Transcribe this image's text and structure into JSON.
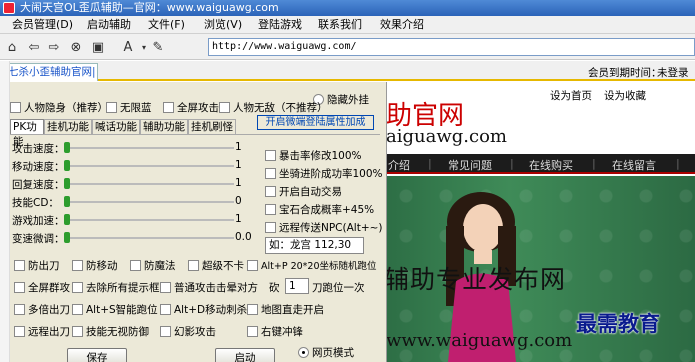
{
  "window": {
    "title": "大闹天宫OL歪瓜辅助—官网：www.waiguawg.com"
  },
  "menu": [
    "会员管理(D)",
    "启动辅助",
    "文件(F)",
    "浏览(V)",
    "登陆游戏",
    "联系我们",
    "效果介绍"
  ],
  "toolbar": {
    "icons": [
      "home-icon",
      "back-icon",
      "forward-icon",
      "stop-icon",
      "refresh-icon",
      "font-icon",
      "dropdown-icon",
      "tools-icon"
    ],
    "address": "http://www.waiguawg.com/"
  },
  "tabs": {
    "main_tab": "七杀小歪辅助官网|大"
  },
  "status": {
    "login_time_label": "会员到期时间：",
    "login_time_value": "未登录或"
  },
  "dialog": {
    "hide_plugin": "隐藏外挂",
    "top_checks": [
      "人物隐身（推荐）",
      "无限蓝",
      "全屏攻击",
      "人物无敌（不推荐）"
    ],
    "subtabs": [
      "PK功能",
      "挂机功能",
      "喊话功能",
      "辅助功能",
      "挂机刷怪"
    ],
    "prop_link": "开启微端登陆属性加成",
    "sliders": [
      {
        "label": "攻击速度：",
        "value": "1",
        "level": 0.0
      },
      {
        "label": "移动速度：",
        "value": "1",
        "level": 0.0
      },
      {
        "label": "回复速度：",
        "value": "1",
        "level": 0.0
      },
      {
        "label": "技能CD：",
        "value": "0",
        "level": 0.0
      },
      {
        "label": "游戏加速：",
        "value": "1",
        "level": 0.0
      },
      {
        "label": "变速微调：",
        "value": "0.0",
        "level": 0.0
      }
    ],
    "right_checks": [
      "暴击率修改100%",
      "坐骑进阶成功率100%",
      "开启自动交易",
      "宝石合成概率+45%",
      "远程传送NPC(Alt+~)"
    ],
    "coord_field": "如：龙宫 112,30",
    "row1": [
      "防出刀",
      "防移动",
      "防魔法",
      "超级不卡",
      "Alt+P 20*20坐标随机跑位"
    ],
    "row2": [
      "全屏群攻",
      "去除所有提示框",
      "普通攻击击晕对方"
    ],
    "kan_label": "砍",
    "kan_value": "1",
    "kan_suffix": "刀跑位一次",
    "row3": [
      "多倍出刀",
      "Alt+S智能跑位",
      "Alt+D移动刺杀",
      "地图直走开启"
    ],
    "row4": [
      "远程出刀",
      "技能无视防御",
      "幻影攻击",
      "右键冲锋"
    ],
    "save_button": "保存",
    "start_button": "启动",
    "web_mode": "网页模式"
  },
  "web": {
    "logo": "助官网",
    "domain": "aiguawg.com",
    "top_links": [
      "设为首页",
      "设为收藏"
    ],
    "nav": [
      "介绍",
      "常见问题",
      "在线购买",
      "在线留言"
    ],
    "slogan": "辅助专业发布网",
    "domain_bottom": "www.waiguawg.com",
    "watermark": "最需教育"
  },
  "colors": {
    "accent": "#1a55c9",
    "tab_underline": "#e6b800",
    "slider_thumb": "#2d9d2d",
    "web_banner": "#3f8b58"
  }
}
